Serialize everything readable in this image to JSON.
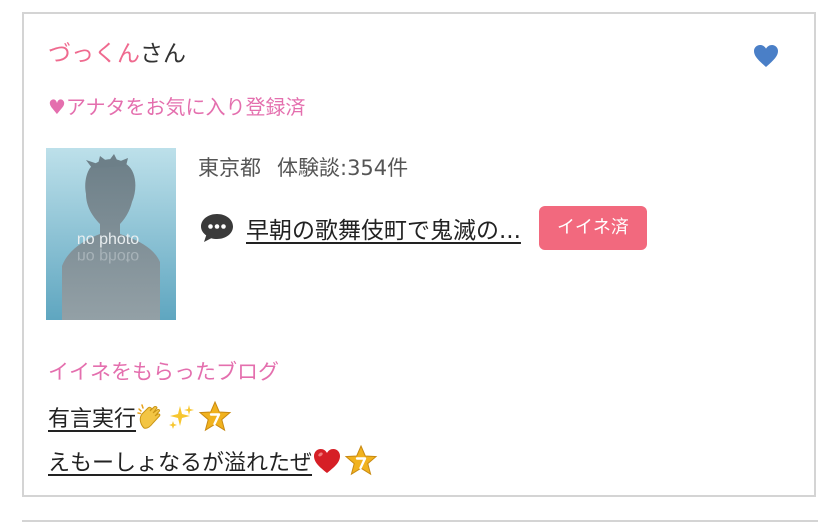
{
  "user": {
    "name": "づっくん",
    "honorific": "さん",
    "favorite_status": "♥アナタをお気に入り登録済",
    "favorite_icon": "blue-heart-icon"
  },
  "profile": {
    "photo_placeholder": "no photo",
    "location": "東京都",
    "review_count_label": "体験談:354件"
  },
  "latest_blog": {
    "icon": "speech-bubble-icon",
    "title": "早朝の歌舞伎町で鬼滅の...",
    "like_button_label": "イイネ済"
  },
  "liked_blogs": {
    "heading": "イイネをもらったブログ",
    "items": [
      {
        "title": "有言実行",
        "emoji": [
          "clapping-hands-icon",
          "sparkles-icon"
        ],
        "badge": "star-badge-icon"
      },
      {
        "title": "えもーしょなるが溢れたぜ",
        "emoji": [
          "red-heart-icon"
        ],
        "badge": "star-badge-icon"
      }
    ]
  },
  "colors": {
    "name_pink": "#ef6a8f",
    "label_pink": "#e46fae",
    "button_pink": "#f2697e",
    "heart_blue": "#4a7fc7",
    "border_gray": "#d4d4d4"
  }
}
